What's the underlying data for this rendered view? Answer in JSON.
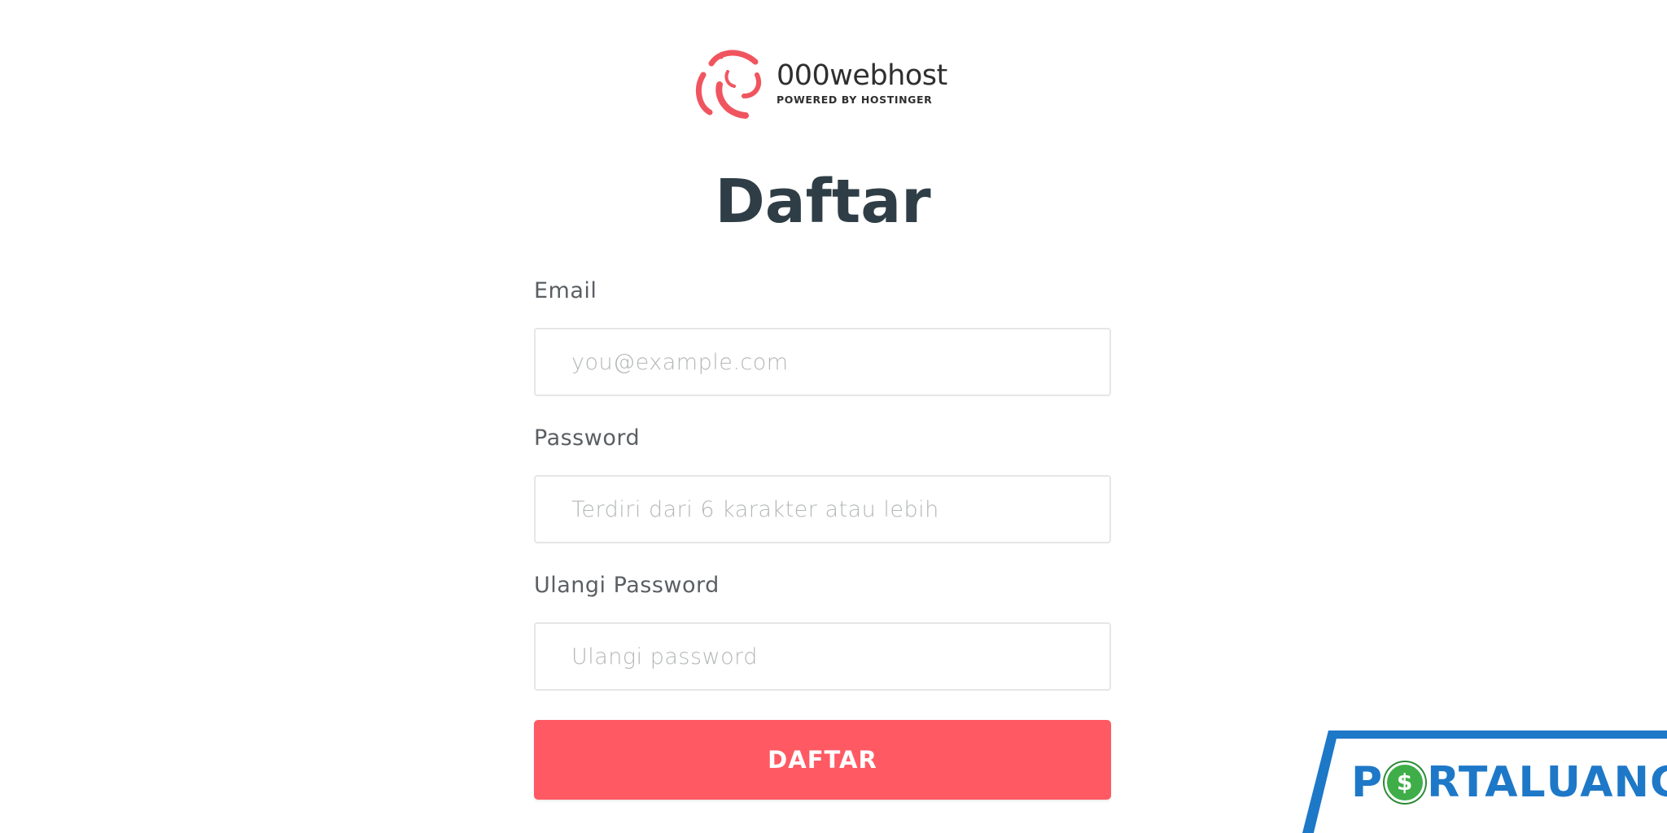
{
  "brand": {
    "name": "000webhost",
    "tagline": "POWERED BY HOSTINGER",
    "logo_icon": "swirl-logo-icon",
    "logo_color": "#f0555f"
  },
  "page": {
    "title": "Daftar"
  },
  "form": {
    "email": {
      "label": "Email",
      "placeholder": "you@example.com",
      "value": ""
    },
    "password": {
      "label": "Password",
      "placeholder": "Terdiri dari 6 karakter atau lebih",
      "value": ""
    },
    "repeat_password": {
      "label": "Ulangi Password",
      "placeholder": "Ulangi password",
      "value": ""
    },
    "submit_label": "DAFTAR"
  },
  "watermark": {
    "text": "PORTALUANG",
    "part_p": "P",
    "part_rtal": "RTAL",
    "part_uang": "UANG",
    "coin_symbol": "$",
    "primary_color": "#1e78c8",
    "coin_color": "#3fae49"
  },
  "colors": {
    "accent": "#ff5a64",
    "title": "#2f3e46",
    "label": "#5a5f63",
    "input_border": "#e6e6e6",
    "placeholder": "#b3b6b8"
  }
}
